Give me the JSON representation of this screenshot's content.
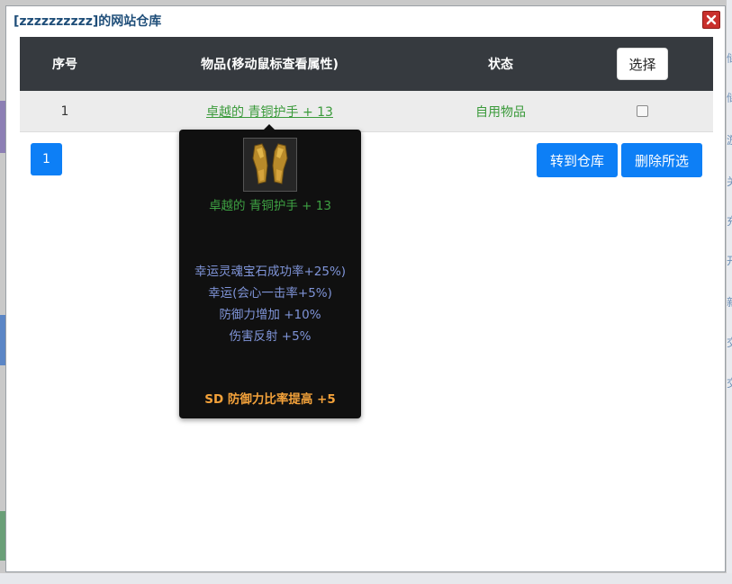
{
  "dialog": {
    "title": "[zzzzzzzzzz]的网站仓库"
  },
  "table": {
    "headers": {
      "index": "序号",
      "item": "物品(移动鼠标查看属性)",
      "status": "状态",
      "select_button": "选择"
    },
    "rows": [
      {
        "index": "1",
        "item_name": "卓越的 青铜护手 + 13",
        "status": "自用物品",
        "checked": false
      }
    ]
  },
  "pagination": {
    "current_page": "1"
  },
  "actions": {
    "move_to_warehouse": "转到仓库",
    "delete_selected": "删除所选"
  },
  "tooltip": {
    "item_name": "卓越的 青铜护手 + 13",
    "options": [
      "幸运灵魂宝石成功率+25%)",
      "幸运(会心一击率+5%)",
      "防御力增加 +10%",
      "伤害反射 +5%"
    ],
    "socket_option": "SD 防御力比率提高 +5"
  },
  "colors": {
    "header_bg": "#363a3f",
    "primary_blue": "#0d7ff6",
    "item_green": "#3a9a3a",
    "option_blue": "#7f94d8",
    "sd_orange": "#f4a23a",
    "close_red": "#c9302c"
  },
  "icons": {
    "close": "close-icon",
    "item": "bronze-gloves-icon"
  },
  "background_glyphs": [
    "储",
    "储",
    "游",
    "关",
    "充",
    "开",
    "新",
    "交",
    "交"
  ]
}
